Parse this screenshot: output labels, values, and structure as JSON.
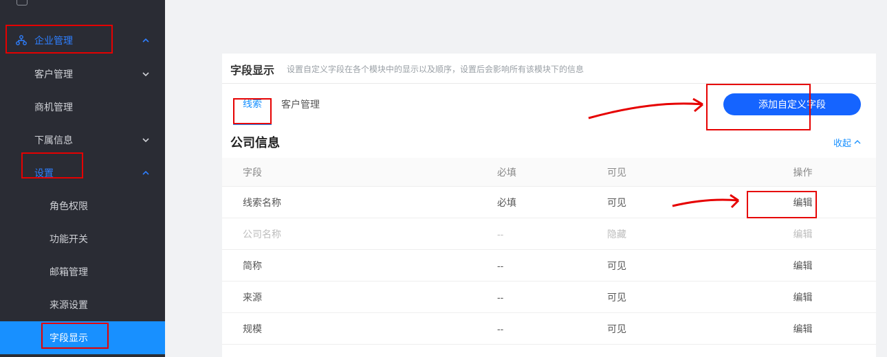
{
  "sidebar": {
    "top_group": {
      "label": "企业管理"
    },
    "items": [
      {
        "label": "客户管理"
      },
      {
        "label": "商机管理"
      },
      {
        "label": "下属信息"
      },
      {
        "label": "设置"
      }
    ],
    "settings_children": [
      {
        "label": "角色权限"
      },
      {
        "label": "功能开关"
      },
      {
        "label": "邮箱管理"
      },
      {
        "label": "来源设置"
      },
      {
        "label": "字段显示"
      }
    ]
  },
  "panel": {
    "title": "字段显示",
    "desc": "设置自定义字段在各个模块中的显示以及顺序，设置后会影响所有该模块下的信息",
    "tabs": [
      {
        "label": "线索"
      },
      {
        "label": "客户管理"
      }
    ],
    "add_button": "添加自定义字段",
    "section_title": "公司信息",
    "collapse": "收起",
    "columns": {
      "field": "字段",
      "required": "必填",
      "visible": "可见",
      "op": "操作"
    },
    "rows": [
      {
        "field": "线索名称",
        "required": "必填",
        "visible": "可见",
        "op": "编辑",
        "disabled": false
      },
      {
        "field": "公司名称",
        "required": "--",
        "visible": "隐藏",
        "op": "编辑",
        "disabled": true
      },
      {
        "field": "简称",
        "required": "--",
        "visible": "可见",
        "op": "编辑",
        "disabled": false
      },
      {
        "field": "来源",
        "required": "--",
        "visible": "可见",
        "op": "编辑",
        "disabled": false
      },
      {
        "field": "规模",
        "required": "--",
        "visible": "可见",
        "op": "编辑",
        "disabled": false
      }
    ]
  }
}
